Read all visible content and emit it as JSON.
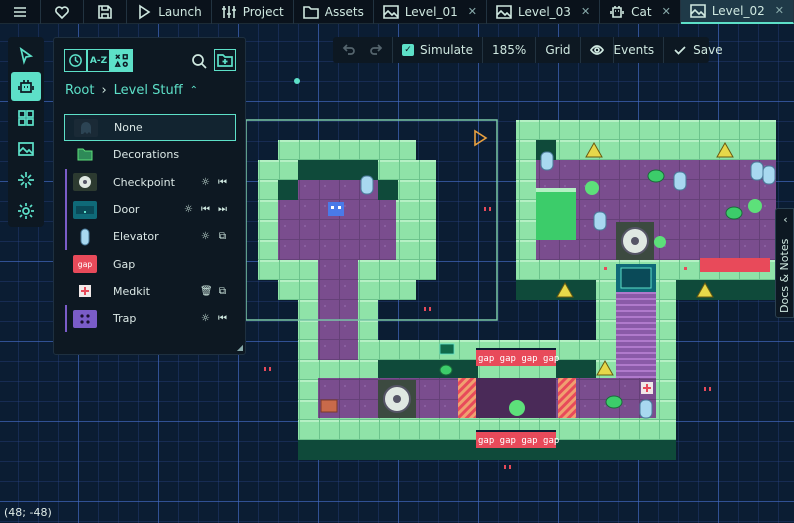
{
  "topbar": {
    "items": [
      {
        "name": "menu-button",
        "icon": "hamburger-icon",
        "label": ""
      },
      {
        "name": "favorite-button",
        "icon": "heart-icon",
        "label": ""
      },
      {
        "name": "save-file-button",
        "icon": "floppy-icon",
        "label": ""
      },
      {
        "name": "launch-button",
        "icon": "play-icon",
        "label": "Launch"
      },
      {
        "name": "project-button",
        "icon": "sliders-icon",
        "label": "Project"
      },
      {
        "name": "assets-button",
        "icon": "folder-icon",
        "label": "Assets"
      }
    ],
    "tabs": [
      {
        "label": "Level_01",
        "icon": "image-icon",
        "active": false
      },
      {
        "label": "Level_03",
        "icon": "image-icon",
        "active": false
      },
      {
        "label": "Cat",
        "icon": "robot-icon",
        "active": false
      },
      {
        "label": "Level_02",
        "icon": "image-icon",
        "active": true
      }
    ],
    "close_glyph": "✕"
  },
  "left_tools": [
    "cursor-icon",
    "robot-icon",
    "grid-icon",
    "image-icon",
    "sparkle-icon",
    "gear-icon"
  ],
  "palette": {
    "sort_az": "A-Z",
    "breadcrumb": {
      "root": "Root",
      "current": "Level Stuff"
    },
    "items": [
      {
        "label": "None",
        "icon": "ghost-icon",
        "color": "#1a2a36",
        "selected": true,
        "actions": []
      },
      {
        "label": "Decorations",
        "icon": "folder-icon",
        "color": "#2e8a58",
        "selected": false,
        "actions": []
      },
      {
        "label": "Checkpoint",
        "icon": "disc-icon",
        "color": "#2c3a30",
        "selected": false,
        "actions": [
          "sun-icon",
          "rewind-icon"
        ]
      },
      {
        "label": "Door",
        "icon": "door-icon",
        "color": "#0f6a78",
        "selected": false,
        "actions": [
          "sun-icon",
          "rewind-icon",
          "forward-icon"
        ]
      },
      {
        "label": "Elevator",
        "icon": "capsule-icon",
        "color": "#6ab0e6",
        "selected": false,
        "actions": [
          "sun-icon",
          "copy-icon"
        ]
      },
      {
        "label": "Gap",
        "icon": "gap-tile",
        "color": "#e84a5a",
        "tile_text": "gap",
        "selected": false,
        "actions": []
      },
      {
        "label": "Medkit",
        "icon": "medkit-icon",
        "color": "#e8e0e0",
        "selected": false,
        "actions": [
          "trash-icon",
          "copy-icon"
        ]
      },
      {
        "label": "Trap",
        "icon": "dice-icon",
        "color": "#7a5cc8",
        "selected": false,
        "actions": [
          "sun-icon",
          "rewind-icon"
        ]
      }
    ]
  },
  "floating_toolbar": {
    "undo": "undo-icon",
    "redo": "redo-icon",
    "simulate": {
      "label": "Simulate",
      "checked": true
    },
    "zoom": "185%",
    "grid": "Grid",
    "events": "Events",
    "save": "Save"
  },
  "docs_tab": "Docs & Notes",
  "coords": "(48; -48)",
  "map": {
    "gap_text": "gap",
    "colors": {
      "wall": "#8fe3a8",
      "floor": "#7a4d8e",
      "dark": "#0f4a3a",
      "accent": "#5de0c8",
      "danger": "#e84a5a"
    }
  }
}
